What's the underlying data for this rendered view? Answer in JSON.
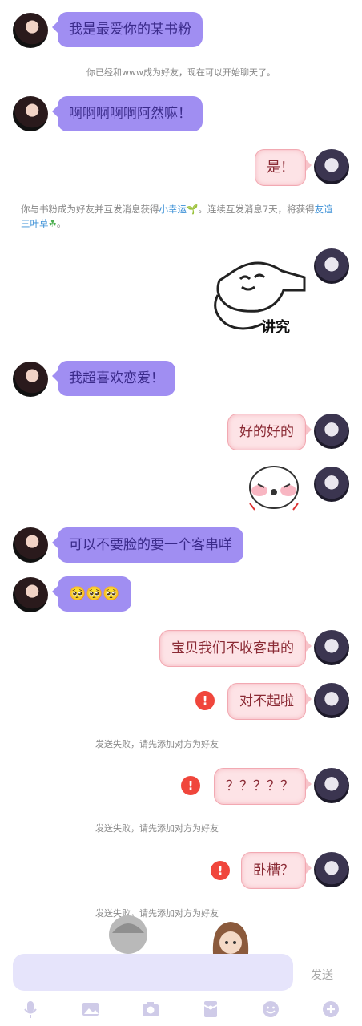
{
  "messages": {
    "m1": "我是最爱你的某书粉",
    "sys1": "你已经和www成为好友，现在可以开始聊天了。",
    "m2": "啊啊啊啊啊阿然嘛！",
    "m3": "是！",
    "sys2_prefix": "你与书粉成为好友并互发消息获得",
    "sys2_link1": "小幸运",
    "sys2_mid": "。连续互发消息7天，将获得",
    "sys2_link2": "友谊三叶草",
    "sys2_end": "。",
    "sticker1_caption": "讲究",
    "m4": "我超喜欢恋爱！",
    "m5": "好的好的",
    "m6": "可以不要脸的要一个客串咩",
    "m7": "🥺🥺🥺",
    "m8": "宝贝我们不收客串的",
    "m9": "对不起啦",
    "sys3": "发送失败，请先添加对方为好友",
    "m10": "？？？？？",
    "sys4": "发送失败，请先添加对方为好友",
    "m11": "卧槽？",
    "sys5": "发送失败，请先添加对方为好友",
    "error_mark": "!"
  },
  "composer": {
    "placeholder": "",
    "send_label": "发送"
  },
  "toolbar": {
    "icons": [
      "microphone-icon",
      "image-icon",
      "camera-icon",
      "red-packet-icon",
      "emoji-icon",
      "plus-icon"
    ]
  },
  "colors": {
    "left_bubble": "#a08ef2",
    "right_bubble": "#fde3e6",
    "error": "#f0463c",
    "link": "#3a8fd6"
  }
}
